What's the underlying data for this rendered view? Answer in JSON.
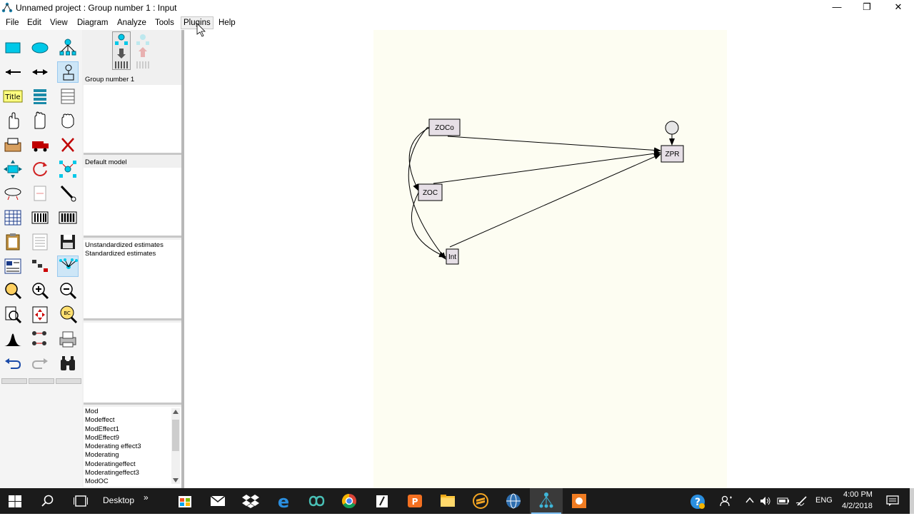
{
  "window": {
    "title": "Unnamed project : Group number 1 : Input",
    "minimize_glyph": "—",
    "restore_glyph": "❐",
    "close_glyph": "✕"
  },
  "menu": [
    "File",
    "Edit",
    "View",
    "Diagram",
    "Analyze",
    "Tools",
    "Plugins",
    "Help"
  ],
  "menu_hovered": "Plugins",
  "panels": {
    "groups": {
      "title": "Group number 1"
    },
    "models": {
      "title": "Default model"
    },
    "estimates": {
      "items": [
        "Unstandardized estimates",
        "Standardized estimates"
      ]
    }
  },
  "file_list": [
    "Mod",
    "Modeffect",
    "ModEffect1",
    "ModEffect9",
    "Moderating effect3",
    "Moderating",
    "Moderatingeffect",
    "Moderatingeffect3",
    "ModOC"
  ],
  "diagram": {
    "variables": [
      "ZOCo",
      "ZOC",
      "Int",
      "ZPR"
    ]
  },
  "taskbar": {
    "desktop_label": "Desktop",
    "language": "ENG",
    "time": "4:00 PM",
    "date": "4/2/2018"
  },
  "colors": {
    "canvas_page": "#fdfdf2",
    "observed_box": "#e6dfe6",
    "taskbar": "#1b1b1b",
    "selected_tool": "#cde6f7"
  }
}
